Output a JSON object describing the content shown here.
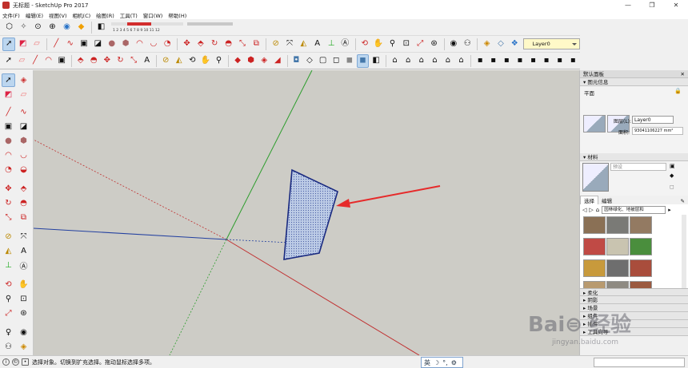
{
  "window": {
    "title": "无标题 - SketchUp Pro 2017",
    "controls": [
      "—",
      "❐",
      "✕"
    ]
  },
  "menu": [
    "文件(F)",
    "编辑(E)",
    "视图(V)",
    "相机(C)",
    "绘图(R)",
    "工具(T)",
    "窗口(W)",
    "帮助(H)"
  ],
  "toolbar": {
    "layer_value": "Layer0",
    "shadow_scale": "1 2 3 4 5 6 7 8 9 10 11 12",
    "row1_icons": [
      "cube",
      "pinch",
      "map-pin",
      "pin-plus",
      "pin-globe",
      "color-cube",
      "shadow-eraser"
    ],
    "row2_icons": [
      "select",
      "paint",
      "eraser",
      "pencil",
      "freehand",
      "rect",
      "rect2",
      "rect3",
      "circle",
      "polygon",
      "arc",
      "arc2",
      "pie",
      "move",
      "rotate",
      "offset",
      "push-pull",
      "scale",
      "measure",
      "protractor",
      "dims",
      "axes",
      "text",
      "3d-text",
      "orbit",
      "pan",
      "zoom",
      "zoom-window",
      "zoom-extents",
      "previous",
      "walk",
      "look",
      "section",
      "camera",
      "sandbox"
    ],
    "row3_icons": [
      "select",
      "eraser",
      "line",
      "arc",
      "rect",
      "shape",
      "move",
      "rotate",
      "scale",
      "text",
      "text2",
      "tape",
      "protractor",
      "orbit",
      "pan",
      "zoom",
      "zoom-ext",
      "model-info",
      "components",
      "styles",
      "scenes",
      "shadows",
      "xray",
      "back-edges",
      "wireframe",
      "hidden",
      "shaded",
      "textured",
      "monochrome",
      "iso",
      "top",
      "front",
      "right",
      "back",
      "left",
      "group",
      "comp",
      "outer",
      "split",
      "trim",
      "intersect",
      "union"
    ]
  },
  "panel": {
    "title": "默认面板",
    "entity_title": "图元信息",
    "entity_type": "平面",
    "layer_label": "图层(L):",
    "layer_value": "Layer0",
    "area_label": "面积:",
    "area_value": "93041106227 mm²",
    "materials_title": "材料",
    "material_name": "预设",
    "tabs": [
      "选择",
      "编辑"
    ],
    "library": "园林绿化、地被层和",
    "collapsed": [
      "柔化",
      "阴影",
      "场景",
      "组件",
      "插件",
      "工具向导"
    ]
  },
  "status": {
    "message": "选择对象。切换到扩充选择。拖动鼠标选择多项。",
    "ime": [
      "英",
      "☽",
      "°,",
      "⚙"
    ]
  },
  "watermark": {
    "text": "Bai⊜ 经验",
    "sub": "jingyan.baidu.com"
  },
  "colors": {
    "axis_red": "#c03030",
    "axis_green": "#2d9d2d",
    "axis_blue": "#2340a0",
    "face_fill": "#b6c6e4",
    "arrow": "#e62a2a",
    "selection": "#1a2a80"
  }
}
